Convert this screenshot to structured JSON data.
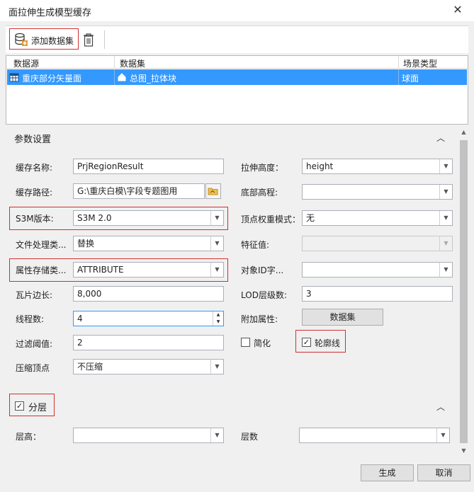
{
  "window": {
    "title": "面拉伸生成模型缓存",
    "close": "✕"
  },
  "toolbar": {
    "add_dataset": "添加数据集"
  },
  "grid": {
    "columns": [
      "数据源",
      "数据集",
      "场景类型"
    ],
    "rows": [
      {
        "source": "重庆部分矢量面",
        "dataset": "总图_拉体块",
        "scene": "球面"
      }
    ]
  },
  "params": {
    "title": "参数设置",
    "cache_name_label": "缓存名称:",
    "cache_name": "PrjRegionResult",
    "cache_path_label": "缓存路径:",
    "cache_path": "G:\\重庆白模\\字段专题图用",
    "s3m_label": "S3M版本:",
    "s3m": "S3M 2.0",
    "file_label": "文件处理类...",
    "file": "替换",
    "attr_label": "属性存储类...",
    "attr": "ATTRIBUTE",
    "tile_label": "瓦片边长:",
    "tile": "8,000",
    "thread_label": "线程数:",
    "thread": "4",
    "filter_label": "过滤阈值:",
    "filter": "2",
    "compress_label": "压缩顶点",
    "compress": "不压缩",
    "extrude_label": "拉伸高度：",
    "extrude": "height",
    "base_label": "底部高程:",
    "base": "",
    "vertex_label": "顶点权重模式：",
    "vertex": "无",
    "feature_label": "特征值:",
    "feature": "",
    "objid_label": "对象ID字...",
    "objid": "",
    "lod_label": "LOD层级数:",
    "lod": "3",
    "extra_label": "附加属性:",
    "extra_btn": "数据集",
    "simplify_label": "简化",
    "outline_label": "轮廓线",
    "outline_check": "✓"
  },
  "layer": {
    "title": "分层",
    "check": "✓",
    "height_label": "层高：",
    "height": "",
    "count_label": "层数",
    "count": ""
  },
  "footer": {
    "ok": "生成",
    "cancel": "取消"
  }
}
